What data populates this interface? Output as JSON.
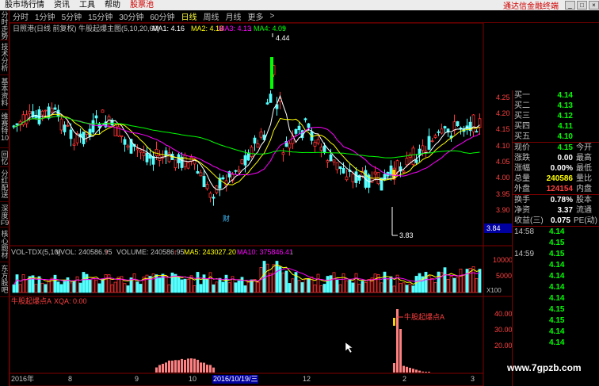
{
  "menubar": {
    "items": [
      "股市场行情",
      "资讯",
      "工具",
      "帮助"
    ],
    "stock_pool": "股票池",
    "brand": "通达信金融终端"
  },
  "periods": [
    "分时",
    "1分钟",
    "5分钟",
    "15分钟",
    "30分钟",
    "60分钟",
    "日线",
    "周线",
    "月线",
    "更多",
    ">"
  ],
  "active_period": "日线",
  "side_tabs": [
    "分时走势",
    "技术分析",
    "基本资料",
    "维赛特10",
    "回忆",
    "分红配送",
    "深度F9",
    "核心题材",
    "东方股吧"
  ],
  "main_title": {
    "name": "日照港(日线 前复权) 牛股起爆主图(5,10,20,60)",
    "ma1": "MA1: 4.16",
    "ma2": "MA2: 4.18",
    "ma3": "MA3: 4.13",
    "ma4": "MA4: 4.09",
    "arrow_down": "↓",
    "arrow_up": "↑"
  },
  "price_axis": [
    "4.25",
    "4.20",
    "4.15",
    "4.10",
    "4.05",
    "4.00",
    "3.95",
    "3.90",
    "3.85"
  ],
  "high_label": "4.44",
  "low_label": "3.83",
  "cai_label": "财",
  "current_price_box": "3.84",
  "vol_title": {
    "name": "VOL-TDX(5,10)",
    "vvol": "VVOL: 240586.95",
    "volume": "VOLUME: 240586.95",
    "ma5": "MA5: 243027.20",
    "ma10": "MA10: 375846.41",
    "arrow_up": "↑",
    "arrow_down": "↓"
  },
  "vol_axis": [
    "10000",
    "5000",
    "X100"
  ],
  "ind_title": {
    "name": "牛股起爆点A",
    "xqa": "XQA: 0.00"
  },
  "ind_axis": [
    "40.00",
    "30.00",
    "20.00"
  ],
  "ind_annotation": "牛股起爆点A",
  "dates": {
    "d1": "2016年",
    "d2": "8",
    "d3": "9",
    "d4": "10",
    "highlight": "2016/10/19/三",
    "d5": "12",
    "d6": "2",
    "d7": "3"
  },
  "quotes": [
    {
      "k": "买一",
      "v": "4.14"
    },
    {
      "k": "买二",
      "v": "4.13"
    },
    {
      "k": "买三",
      "v": "4.12"
    },
    {
      "k": "买四",
      "v": "4.11"
    },
    {
      "k": "买五",
      "v": "4.10"
    }
  ],
  "stats": [
    {
      "k": "现价",
      "v": "4.15",
      "k2": "今开"
    },
    {
      "k": "涨跌",
      "v": "0.00",
      "k2": "最高"
    },
    {
      "k": "涨幅",
      "v": "0.00%",
      "k2": "最低"
    },
    {
      "k": "总量",
      "v": "240586",
      "k2": "量比"
    },
    {
      "k": "外盘",
      "v": "124154",
      "k2": "内盘"
    }
  ],
  "stats2": [
    {
      "k": "换手",
      "v": "0.78%",
      "k2": "股本"
    },
    {
      "k": "净资",
      "v": "3.37",
      "k2": "流通"
    },
    {
      "k": "收益(三)",
      "v": "0.075",
      "k2": "PE(动)"
    }
  ],
  "ticks": [
    {
      "t": "14:58",
      "p": "4.14"
    },
    {
      "t": "",
      "p": "4.15"
    },
    {
      "t": "14:59",
      "p": "4.15"
    },
    {
      "t": "",
      "p": "4.14"
    },
    {
      "t": "",
      "p": "4.14"
    },
    {
      "t": "",
      "p": "4.14"
    },
    {
      "t": "",
      "p": "4.14"
    },
    {
      "t": "",
      "p": "4.15"
    },
    {
      "t": "",
      "p": "4.15"
    },
    {
      "t": "",
      "p": "4.14"
    },
    {
      "t": "",
      "p": "4.14"
    }
  ],
  "watermark": "www.7gpzb.com",
  "colors": {
    "up": "#ff3232",
    "down": "#54ffff",
    "ma1": "#ffffff",
    "ma2": "#ffff00",
    "ma3": "#ff00ff",
    "ma4": "#00ff00",
    "grid": "#800000"
  }
}
